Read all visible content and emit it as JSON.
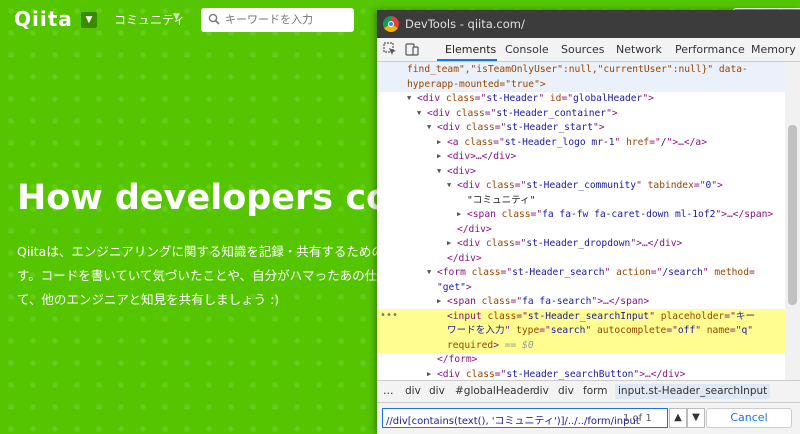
{
  "site": {
    "logo": "Qiita",
    "community_label": "コミュニティ",
    "search_placeholder": "キーワードを入力",
    "hero_title": "How developers code",
    "hero_lines": [
      "Qiitaは、エンジニアリングに関する知識を記録・共有するためのサ",
      "す。コードを書いていて気づいたことや、自分がハマったあの仕様",
      "て、他のエンジニアと知見を共有しましょう :)"
    ]
  },
  "devtools": {
    "window_title": "DevTools - qiita.com/",
    "tabs": [
      "Elements",
      "Console",
      "Sources",
      "Network",
      "Performance",
      "Memory"
    ],
    "active_tab": "Elements",
    "selected_suffix": "== $0",
    "breadcrumbs": [
      "…",
      "div",
      "div",
      "#globalHeader",
      "div",
      "div",
      "form",
      "input.st-Header_searchInput"
    ],
    "find": {
      "query": "//div[contains(text(), 'コミュニティ')]/../../form/input",
      "count": "1 of 1",
      "cancel_label": "Cancel"
    },
    "code_lines": [
      {
        "indent": 1,
        "tri": "",
        "parts": [
          [
            "a",
            "find_team\",\"isTeamOnlyUser\":null,\"currentUser\":null}\" data-"
          ]
        ]
      },
      {
        "indent": 1,
        "tri": "",
        "parts": [
          [
            "a",
            "hyperapp-mounted=\"true\">"
          ]
        ]
      },
      {
        "indent": 2,
        "tri": "▼",
        "parts": [
          [
            "t",
            "<div "
          ],
          [
            "a",
            "class"
          ],
          [
            "t",
            "=\""
          ],
          [
            "v",
            "st-Header"
          ],
          [
            "t",
            "\" "
          ],
          [
            "a",
            "id"
          ],
          [
            "t",
            "=\""
          ],
          [
            "v",
            "globalHeader"
          ],
          [
            "t",
            "\">"
          ]
        ]
      },
      {
        "indent": 3,
        "tri": "▼",
        "parts": [
          [
            "t",
            "<div "
          ],
          [
            "a",
            "class"
          ],
          [
            "t",
            "=\""
          ],
          [
            "v",
            "st-Header_container"
          ],
          [
            "t",
            "\">"
          ]
        ]
      },
      {
        "indent": 4,
        "tri": "▼",
        "parts": [
          [
            "t",
            "<div "
          ],
          [
            "a",
            "class"
          ],
          [
            "t",
            "=\""
          ],
          [
            "v",
            "st-Header_start"
          ],
          [
            "t",
            "\">"
          ]
        ]
      },
      {
        "indent": 5,
        "tri": "▶",
        "parts": [
          [
            "t",
            "<a "
          ],
          [
            "a",
            "class"
          ],
          [
            "t",
            "=\""
          ],
          [
            "v",
            "st-Header_logo mr-1"
          ],
          [
            "t",
            "\" "
          ],
          [
            "a",
            "href"
          ],
          [
            "t",
            "=\""
          ],
          [
            "v",
            "/"
          ],
          [
            "t",
            "\">…</a>"
          ]
        ]
      },
      {
        "indent": 5,
        "tri": "▶",
        "parts": [
          [
            "t",
            "<div>…</div>"
          ]
        ]
      },
      {
        "indent": 5,
        "tri": "▼",
        "parts": [
          [
            "t",
            "<div>"
          ]
        ]
      },
      {
        "indent": 6,
        "tri": "▼",
        "parts": [
          [
            "t",
            "<div "
          ],
          [
            "a",
            "class"
          ],
          [
            "t",
            "=\""
          ],
          [
            "v",
            "st-Header_community"
          ],
          [
            "t",
            "\" "
          ],
          [
            "a",
            "tabindex"
          ],
          [
            "t",
            "=\""
          ],
          [
            "v",
            "0"
          ],
          [
            "t",
            "\">"
          ]
        ]
      },
      {
        "indent": 7,
        "tri": "",
        "parts": [
          [
            "x",
            "\"コミュニティ\""
          ]
        ]
      },
      {
        "indent": 7,
        "tri": "▶",
        "parts": [
          [
            "t",
            "<span "
          ],
          [
            "a",
            "class"
          ],
          [
            "t",
            "=\""
          ],
          [
            "v",
            "fa fa-fw fa-caret-down ml-1of2"
          ],
          [
            "t",
            "\">…</span>"
          ]
        ]
      },
      {
        "indent": 6,
        "tri": "",
        "parts": [
          [
            "t",
            "</div>"
          ]
        ]
      },
      {
        "indent": 6,
        "tri": "▶",
        "parts": [
          [
            "t",
            "<div "
          ],
          [
            "a",
            "class"
          ],
          [
            "t",
            "=\""
          ],
          [
            "v",
            "st-Header_dropdown"
          ],
          [
            "t",
            "\">…</div>"
          ]
        ]
      },
      {
        "indent": 5,
        "tri": "",
        "parts": [
          [
            "t",
            "</div>"
          ]
        ]
      },
      {
        "indent": 4,
        "tri": "▼",
        "parts": [
          [
            "t",
            "<form "
          ],
          [
            "a",
            "class"
          ],
          [
            "t",
            "=\""
          ],
          [
            "v",
            "st-Header_search"
          ],
          [
            "t",
            "\" "
          ],
          [
            "a",
            "action"
          ],
          [
            "t",
            "=\""
          ],
          [
            "v",
            "/search"
          ],
          [
            "t",
            "\" "
          ],
          [
            "a",
            "method"
          ],
          [
            "t",
            "="
          ]
        ]
      },
      {
        "indent": 4,
        "tri": "",
        "parts": [
          [
            "v",
            "\"get\""
          ],
          [
            "t",
            ">"
          ]
        ]
      },
      {
        "indent": 5,
        "tri": "▶",
        "parts": [
          [
            "t",
            "<span "
          ],
          [
            "a",
            "class"
          ],
          [
            "t",
            "=\""
          ],
          [
            "v",
            "fa fa-search"
          ],
          [
            "t",
            "\">…</span>"
          ]
        ]
      },
      {
        "indent": 5,
        "tri": "",
        "hl": true,
        "parts": [
          [
            "t",
            "<input "
          ],
          [
            "a",
            "class"
          ],
          [
            "t",
            "=\""
          ],
          [
            "v",
            "st-Header_searchInput"
          ],
          [
            "t",
            "\" "
          ],
          [
            "a",
            "placeholder"
          ],
          [
            "t",
            "=\""
          ],
          [
            "v",
            "キー"
          ]
        ]
      },
      {
        "indent": 5,
        "tri": "",
        "hl": true,
        "parts": [
          [
            "v",
            "ワードを入力"
          ],
          [
            "t",
            "\" "
          ],
          [
            "a",
            "type"
          ],
          [
            "t",
            "=\""
          ],
          [
            "v",
            "search"
          ],
          [
            "t",
            "\" "
          ],
          [
            "a",
            "autocomplete"
          ],
          [
            "t",
            "=\""
          ],
          [
            "v",
            "off"
          ],
          [
            "t",
            "\" "
          ],
          [
            "a",
            "name"
          ],
          [
            "t",
            "=\""
          ],
          [
            "v",
            "q"
          ],
          [
            "t",
            "\""
          ]
        ]
      },
      {
        "indent": 5,
        "tri": "",
        "hl": true,
        "parts": [
          [
            "a",
            "required"
          ],
          [
            "t",
            "> "
          ],
          [
            "e",
            "== $0"
          ]
        ]
      },
      {
        "indent": 4,
        "tri": "",
        "parts": [
          [
            "t",
            "</form>"
          ]
        ]
      },
      {
        "indent": 4,
        "tri": "▶",
        "parts": [
          [
            "t",
            "<div "
          ],
          [
            "a",
            "class"
          ],
          [
            "t",
            "=\""
          ],
          [
            "v",
            "st-Header_searchButton"
          ],
          [
            "t",
            "\">…</div>"
          ]
        ]
      },
      {
        "indent": 4,
        "tri": "",
        "parts": [
          [
            "t",
            "</div>"
          ]
        ]
      }
    ]
  }
}
